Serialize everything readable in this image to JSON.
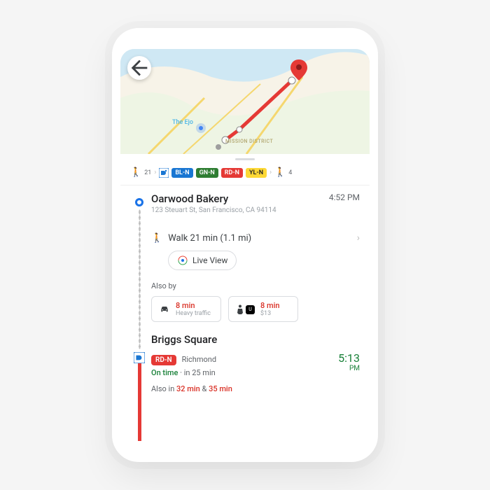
{
  "map": {
    "poi": "The Ejo",
    "district": "MISSION DISTRICT"
  },
  "summary": {
    "walk_start": "21",
    "transit_icon": "ba",
    "lines": [
      {
        "label": "BL-N",
        "color": "#1976d2"
      },
      {
        "label": "GN-N",
        "color": "#2e7d32"
      },
      {
        "label": "RD-N",
        "color": "#e53935"
      },
      {
        "label": "YL-N",
        "color": "#fdd835",
        "text": "#202124"
      }
    ],
    "walk_end": "4"
  },
  "start": {
    "name": "Oarwood Bakery",
    "address": "123 Steuart St, San Francisco, CA 94114",
    "time": "4:52 PM"
  },
  "walk": {
    "text": "Walk 21 min (1.1 mi)",
    "live_view": "Live View"
  },
  "also_by": {
    "label": "Also by",
    "car": {
      "mins": "8 min",
      "sub": "Heavy traffic"
    },
    "uber": {
      "mins": "8 min",
      "sub": "$13"
    }
  },
  "station": {
    "name": "Briggs Square",
    "route_label": "RD-N",
    "route_dest": "Richmond",
    "on_time": "On time",
    "in": "in 25 min",
    "depart_time": "5:13",
    "depart_ampm": "PM",
    "also_in_prefix": "Also in ",
    "also_in_1": "32 min",
    "also_in_amp": " & ",
    "also_in_2": "35 min"
  }
}
